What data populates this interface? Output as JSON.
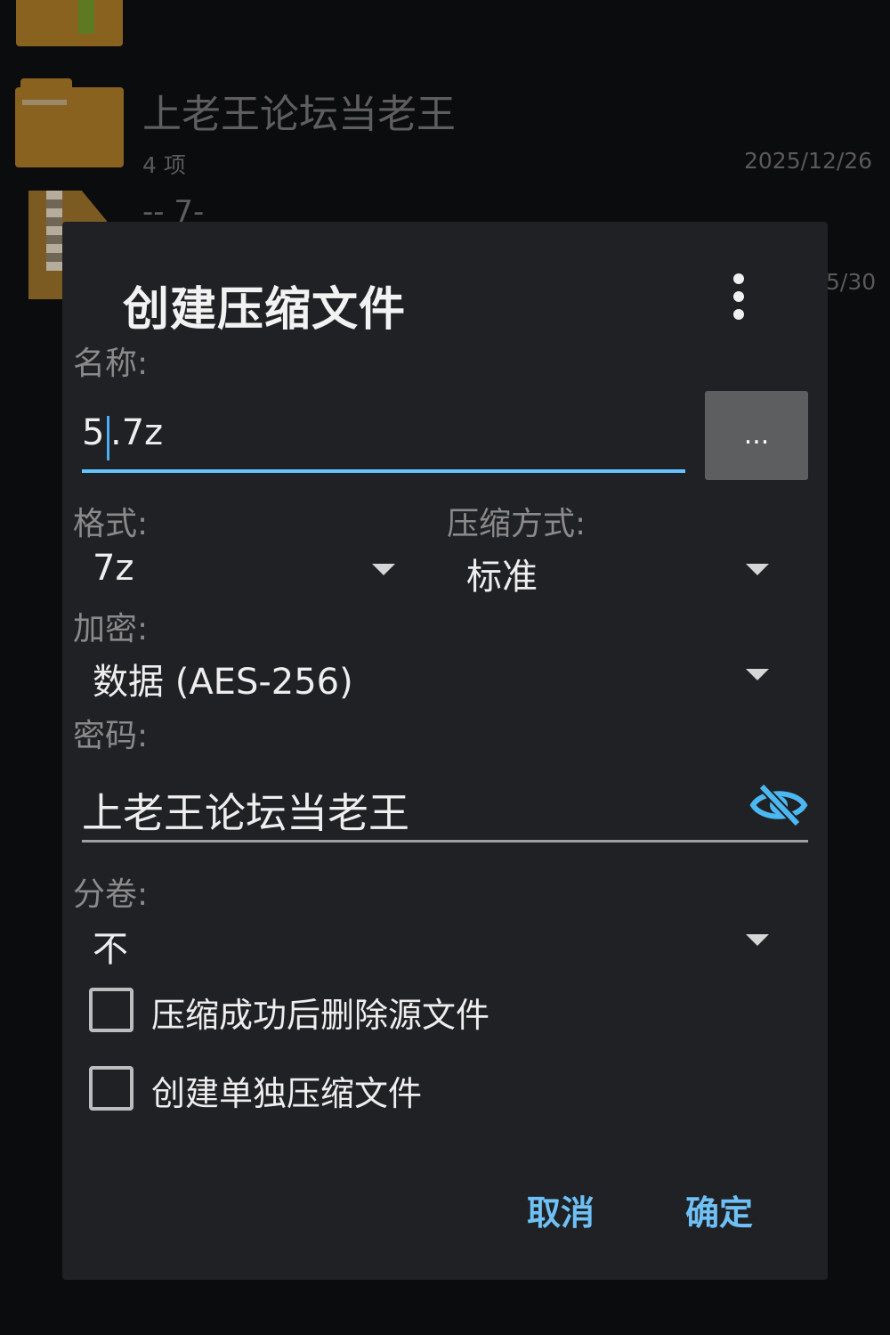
{
  "background": {
    "folder_name": "上老王论坛当老王",
    "folder_count": "4 项",
    "folder_date": "2025/12/26",
    "partial_file_name": "-- 7-",
    "partial_date": "5/30"
  },
  "dialog": {
    "title": "创建压缩文件",
    "name_label": "名称:",
    "name_value_before_caret": "5",
    "name_value_after_caret": ".7z",
    "browse_label": "...",
    "format_label": "格式:",
    "format_value": "7z",
    "method_label": "压缩方式:",
    "method_value": "标准",
    "encryption_label": "加密:",
    "encryption_value": "数据 (AES-256)",
    "password_label": "密码:",
    "password_value": "上老王论坛当老王",
    "split_label": "分卷:",
    "split_value": "不",
    "checkbox_delete": "压缩成功后删除源文件",
    "checkbox_separate": "创建单独压缩文件",
    "cancel": "取消",
    "ok": "确定"
  },
  "colors": {
    "accent": "#65c3ff",
    "button_text": "#6ec0f5",
    "dialog_bg": "#1f2124"
  },
  "icons": {
    "more": "more-vertical-icon",
    "eye": "eye-off-icon",
    "dropdown": "dropdown-arrow-icon"
  }
}
